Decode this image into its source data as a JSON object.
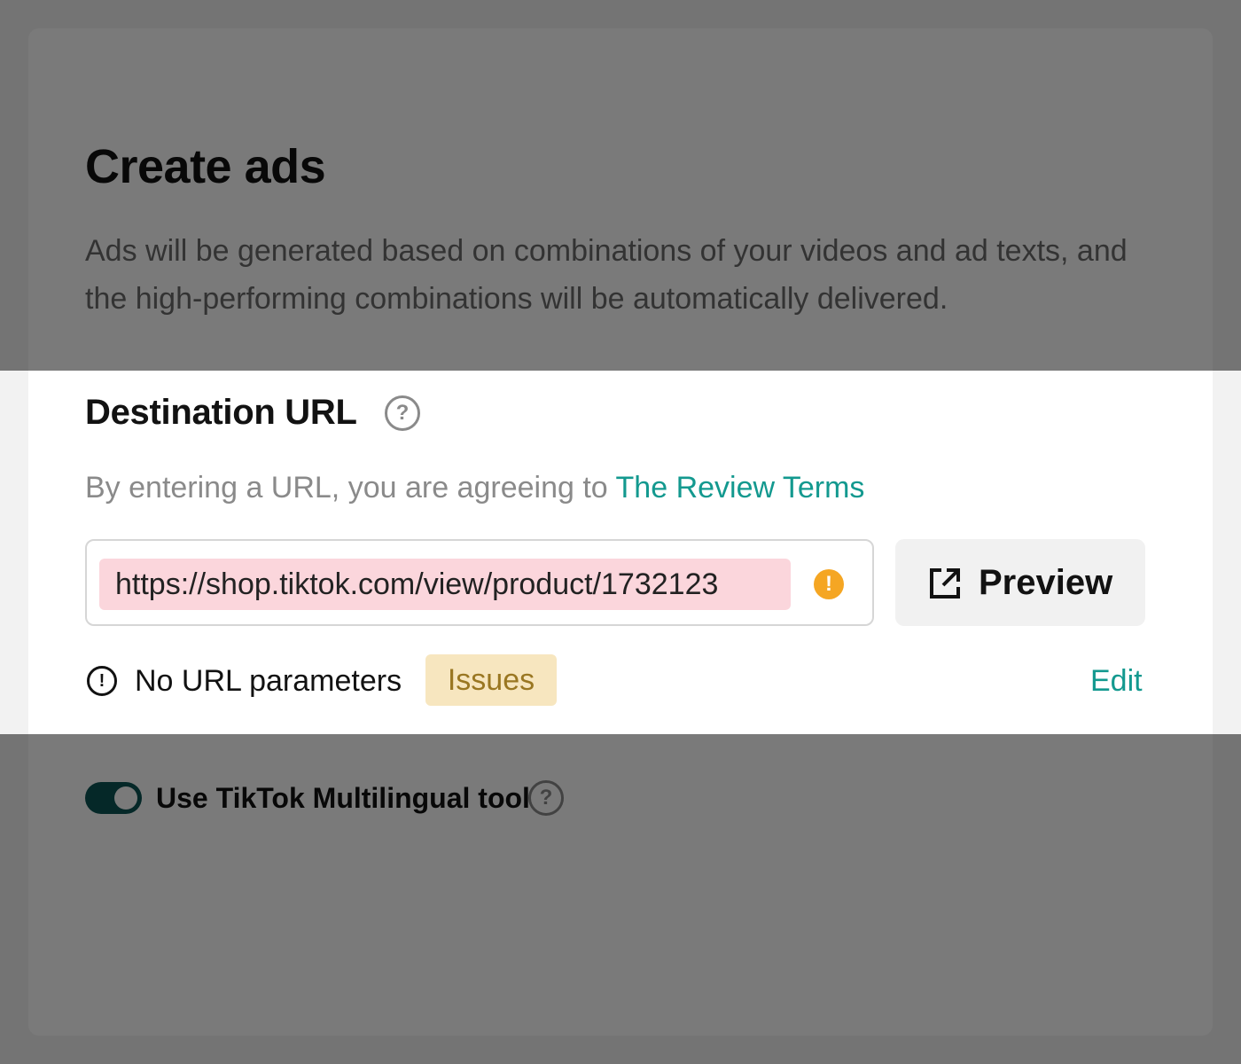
{
  "header": {
    "title": "Create ads",
    "description": "Ads will be generated based on combinations of your videos and ad texts, and the high-performing combinations will be automatically delivered."
  },
  "destination": {
    "title": "Destination URL",
    "help_glyph": "?",
    "terms_prefix": "By entering a URL, you are agreeing to ",
    "terms_link": "The Review Terms",
    "url_value": "https://shop.tiktok.com/view/product/1732123",
    "warning_glyph": "!",
    "preview_label": "Preview",
    "param_glyph": "!",
    "param_label": "No URL parameters",
    "issues_badge": "Issues",
    "edit_label": "Edit"
  },
  "multilingual": {
    "toggle_on": true,
    "label": "Use TikTok Multilingual tool",
    "help_glyph": "?"
  },
  "icons": {
    "destination_help": "question-circle-icon",
    "url_warning": "warning-circle-icon",
    "preview": "external-link-icon",
    "param_info": "exclamation-circle-icon",
    "multilingual_help": "question-circle-icon"
  },
  "colors": {
    "accent_link": "#13998f",
    "toggle_on": "#0c5454",
    "warning": "#f5a623",
    "url_highlight": "#fbd6dc",
    "issues_bg": "#f7e6bf",
    "issues_text": "#9a7722",
    "overlay": "rgba(0,0,0,0.52)"
  }
}
